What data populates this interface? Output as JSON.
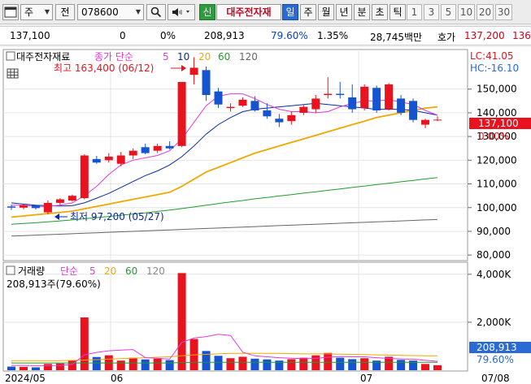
{
  "toolbar": {
    "window_icon": "window-icon",
    "market": "주",
    "view_toggle": "전",
    "code": "078600",
    "search_icon": "search-icon",
    "sound_icon": "speaker-icon",
    "new_badge": "신",
    "stock_name": "대주전자재",
    "periods": [
      "일",
      "주",
      "월",
      "년",
      "분",
      "초",
      "틱"
    ],
    "selected_period": "일",
    "intervals": [
      "1",
      "3",
      "5",
      "10",
      "20",
      "30"
    ]
  },
  "quote": {
    "price": "137,100",
    "change": "0",
    "change_rate": "0%",
    "volume": "208,913",
    "vol_ratio": "79.60%",
    "turnover_rate": "1.35%",
    "amount": "28,745백만",
    "ask_label": "호가",
    "ask_price": "137,200",
    "bid_price": "136"
  },
  "price_panel": {
    "stock_label": "대주전자재료",
    "ma_label": "종가 단순",
    "ma_periods": [
      "5",
      "10",
      "20",
      "60",
      "120"
    ],
    "high_annotation": "최고 163,400 (06/12)",
    "low_annotation": "최저 97,200 (05/27)",
    "lc_label": "LC:41.05",
    "hc_label": "HC:-16.10",
    "current_price_tag": "137,100",
    "current_change_tag": "0.00%",
    "settings_icon": "grid-settings-icon"
  },
  "volume_panel": {
    "title": "거래량",
    "ma_label": "단순",
    "ma_periods": [
      "5",
      "20",
      "60",
      "120"
    ],
    "summary": "208,913주(79.60%)",
    "current_volume_tag": "208,913",
    "current_ratio_tag": "79.60%"
  },
  "x_labels": {
    "start": "2024/05",
    "m06": "06",
    "m07": "07",
    "end": "07/08"
  },
  "colors": {
    "up": "#e8131f",
    "down": "#1553d1",
    "ma5": "#e23bd8",
    "ma10": "#0a2aa6",
    "ma20": "#f0a800",
    "ma60": "#1f9c2e",
    "ma120": "#666666",
    "lc_hc": "#e8131f",
    "axis_blue": "#2a6ad4"
  },
  "chart_data": {
    "type": "candlestick",
    "y_ticks": [
      "150,000",
      "140,000",
      "130,000",
      "120,000",
      "110,000",
      "100,000",
      "90,000",
      "80,000"
    ],
    "volume_ticks": [
      "4,000K",
      "2,000K"
    ],
    "ylim": [
      78000,
      166000
    ],
    "volume_ylim": [
      0,
      4400
    ],
    "candles": [
      {
        "o": 100500,
        "h": 101200,
        "l": 99000,
        "c": 100000
      },
      {
        "o": 100000,
        "h": 101500,
        "l": 99300,
        "c": 101000
      },
      {
        "o": 101000,
        "h": 101200,
        "l": 99200,
        "c": 99800
      },
      {
        "o": 98000,
        "h": 103000,
        "l": 97200,
        "c": 102000
      },
      {
        "o": 102000,
        "h": 104000,
        "l": 101000,
        "c": 103500
      },
      {
        "o": 103000,
        "h": 105500,
        "l": 102500,
        "c": 105000
      },
      {
        "o": 104000,
        "h": 122500,
        "l": 103500,
        "c": 122000
      },
      {
        "o": 120500,
        "h": 121800,
        "l": 118500,
        "c": 119000
      },
      {
        "o": 120000,
        "h": 123000,
        "l": 119000,
        "c": 121500
      },
      {
        "o": 118500,
        "h": 123500,
        "l": 117500,
        "c": 122000
      },
      {
        "o": 122000,
        "h": 125000,
        "l": 120500,
        "c": 124000
      },
      {
        "o": 125500,
        "h": 127000,
        "l": 122500,
        "c": 123000
      },
      {
        "o": 124000,
        "h": 127000,
        "l": 123000,
        "c": 126000
      },
      {
        "o": 126000,
        "h": 128000,
        "l": 124500,
        "c": 125000
      },
      {
        "o": 126000,
        "h": 153000,
        "l": 125500,
        "c": 153000
      },
      {
        "o": 156000,
        "h": 163400,
        "l": 152000,
        "c": 159000
      },
      {
        "o": 158000,
        "h": 159500,
        "l": 145000,
        "c": 147500
      },
      {
        "o": 149000,
        "h": 150500,
        "l": 142000,
        "c": 143500
      },
      {
        "o": 142000,
        "h": 144000,
        "l": 140500,
        "c": 142500
      },
      {
        "o": 143000,
        "h": 146500,
        "l": 142500,
        "c": 145500
      },
      {
        "o": 145000,
        "h": 147000,
        "l": 140500,
        "c": 141000
      },
      {
        "o": 141000,
        "h": 144000,
        "l": 137500,
        "c": 138500
      },
      {
        "o": 137500,
        "h": 139500,
        "l": 134000,
        "c": 136000
      },
      {
        "o": 136500,
        "h": 140500,
        "l": 135000,
        "c": 139000
      },
      {
        "o": 140000,
        "h": 143500,
        "l": 139000,
        "c": 142500
      },
      {
        "o": 141500,
        "h": 147500,
        "l": 140000,
        "c": 146000
      },
      {
        "o": 147500,
        "h": 155000,
        "l": 146000,
        "c": 148000
      },
      {
        "o": 148000,
        "h": 153000,
        "l": 146000,
        "c": 147500
      },
      {
        "o": 146500,
        "h": 152000,
        "l": 140000,
        "c": 141500
      },
      {
        "o": 142000,
        "h": 152000,
        "l": 141000,
        "c": 151000
      },
      {
        "o": 150500,
        "h": 151500,
        "l": 140000,
        "c": 141000
      },
      {
        "o": 141500,
        "h": 152500,
        "l": 141000,
        "c": 152000
      },
      {
        "o": 146000,
        "h": 147500,
        "l": 139000,
        "c": 140000
      },
      {
        "o": 145000,
        "h": 146000,
        "l": 136000,
        "c": 137000
      },
      {
        "o": 135000,
        "h": 137500,
        "l": 133500,
        "c": 137000
      },
      {
        "o": 137100,
        "h": 138500,
        "l": 136500,
        "c": 137100
      }
    ],
    "volume": [
      150,
      140,
      120,
      260,
      280,
      420,
      2200,
      550,
      620,
      400,
      520,
      450,
      480,
      420,
      4050,
      1300,
      800,
      600,
      500,
      560,
      480,
      450,
      400,
      460,
      520,
      620,
      720,
      520,
      460,
      500,
      400,
      560,
      430,
      400,
      260,
      209
    ],
    "ma5": [
      101000,
      101000,
      100500,
      100500,
      101000,
      102000,
      105000,
      109000,
      114000,
      118000,
      120000,
      121000,
      122000,
      124000,
      129000,
      136000,
      143000,
      147000,
      148000,
      148000,
      146000,
      143500,
      141500,
      140500,
      140500,
      140000,
      140500,
      142500,
      144000,
      145000,
      145000,
      145500,
      144500,
      143500,
      141000,
      139000
    ],
    "ma10": [
      102000,
      101500,
      101000,
      100800,
      100700,
      100800,
      102000,
      104000,
      106000,
      108500,
      111000,
      113500,
      115500,
      118000,
      121500,
      126000,
      131000,
      135000,
      138000,
      140500,
      141500,
      142000,
      142500,
      143000,
      143500,
      144000,
      143500,
      143000,
      142500,
      142000,
      141500,
      141500,
      141500,
      141000,
      140000,
      139000
    ],
    "ma20": [
      96000,
      96500,
      97000,
      97500,
      98000,
      98500,
      99500,
      100500,
      101500,
      102500,
      103500,
      104500,
      105500,
      106500,
      109000,
      112000,
      115000,
      117000,
      119000,
      121000,
      123000,
      124500,
      126000,
      127500,
      129000,
      130500,
      132000,
      133500,
      135000,
      136500,
      138000,
      139000,
      140000,
      141000,
      142000,
      142500
    ],
    "ma60": [
      93000,
      93300,
      93600,
      94000,
      94400,
      94800,
      95300,
      95800,
      96300,
      96800,
      97300,
      97800,
      98400,
      99000,
      99600,
      100300,
      101000,
      101700,
      102400,
      103000,
      103700,
      104300,
      104900,
      105500,
      106100,
      106700,
      107300,
      107900,
      108500,
      109100,
      109700,
      110300,
      110900,
      111500,
      112100,
      112700
    ],
    "ma120": [
      88000,
      88200,
      88400,
      88600,
      88800,
      89000,
      89200,
      89400,
      89600,
      89800,
      90000,
      90200,
      90400,
      90600,
      90800,
      91000,
      91200,
      91400,
      91600,
      91800,
      92000,
      92200,
      92400,
      92600,
      92800,
      93000,
      93200,
      93400,
      93600,
      93800,
      94000,
      94200,
      94400,
      94600,
      94800,
      95000
    ],
    "vol_ma5": [
      200,
      200,
      190,
      190,
      200,
      240,
      640,
      740,
      810,
      840,
      860,
      520,
      500,
      460,
      1160,
      1340,
      1400,
      1500,
      1450,
      750,
      600,
      560,
      520,
      500,
      480,
      490,
      540,
      570,
      560,
      560,
      520,
      490,
      470,
      460,
      410,
      370
    ],
    "vol_ma20": [
      400,
      400,
      400,
      400,
      400,
      410,
      420,
      440,
      460,
      480,
      500,
      520,
      540,
      560,
      600,
      640,
      660,
      680,
      700,
      700,
      700,
      700,
      700,
      690,
      680,
      680,
      680,
      670,
      660,
      650,
      640,
      630,
      620,
      610,
      600,
      600
    ],
    "vol_ma60": [
      300,
      300,
      300,
      300,
      300,
      300,
      300,
      300,
      300,
      300,
      300,
      300,
      300,
      300,
      320,
      330,
      330,
      330,
      330,
      330,
      330,
      330,
      330,
      330,
      330,
      330,
      330,
      330,
      330,
      330,
      330,
      330,
      330,
      330,
      330,
      330
    ]
  }
}
